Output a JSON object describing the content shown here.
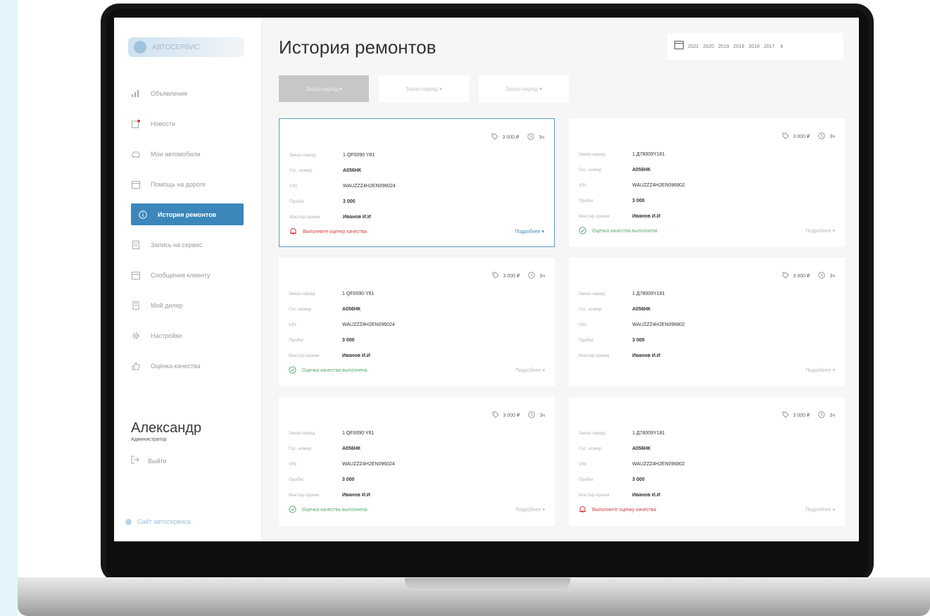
{
  "page": {
    "title": "История ремонтов"
  },
  "logo": {
    "text": "АВТОСЕРВИС"
  },
  "sidebar": {
    "items": [
      {
        "label": "Объявления",
        "icon": "chart-icon",
        "active": false
      },
      {
        "label": "Новости",
        "icon": "news-icon",
        "active": false
      },
      {
        "label": "Мои автомобили",
        "icon": "car-icon",
        "active": false
      },
      {
        "label": "Помощь на дороге",
        "icon": "calendar-icon",
        "active": false
      },
      {
        "label": "История ремонтов",
        "icon": "info-icon",
        "active": true
      },
      {
        "label": "Запись на сервис",
        "icon": "doc-icon",
        "active": false
      },
      {
        "label": "Сообщения клиенту",
        "icon": "calendar-icon",
        "active": false
      },
      {
        "label": "Мой дилер",
        "icon": "building-icon",
        "active": false
      },
      {
        "label": "Настройки",
        "icon": "gear-icon",
        "active": false
      },
      {
        "label": "Оценка качества",
        "icon": "thumb-icon",
        "active": false
      }
    ]
  },
  "user": {
    "name": "Александр",
    "role": "Администратор",
    "logout_label": "Выйти"
  },
  "footer": {
    "link": "Сайт автосервиса"
  },
  "years": [
    "2021",
    "2020",
    "2019",
    "2018",
    "2018",
    "2017"
  ],
  "filters": [
    {
      "label": "Заказ-наряд ▾",
      "active": true
    },
    {
      "label": "Заказ-наряд ▾",
      "active": false
    },
    {
      "label": "Заказ-наряд ▾",
      "active": false
    }
  ],
  "labels": {
    "order": "Заказ-наряд",
    "plate": "Гос. номер",
    "vin": "VIN",
    "mileage": "Пробег",
    "master": "Мастер-прием",
    "details": "Подробнее ▾"
  },
  "cards": [
    {
      "price": "3 000 ₽",
      "time": "3ч",
      "order": "1 QF0090 Y81",
      "plate": "А056НК",
      "vin": "WAUZZZ4H2EN096024",
      "mileage": "3 000",
      "master": "Иванов И.И",
      "status": "Выполните оценку качества",
      "status_type": "err",
      "selected": true
    },
    {
      "price": "3 000 ₽",
      "time": "3ч",
      "order": "1 Д78009Y181",
      "plate": "А056НК",
      "vin": "WAUZZZ4H2EN096802",
      "mileage": "3 000",
      "master": "Иванов И.И",
      "status": "Оценка качества выполнена",
      "status_type": "ok",
      "selected": false
    },
    {
      "price": "3 000 ₽",
      "time": "3ч",
      "order": "1 QF0090 Y81",
      "plate": "А056НК",
      "vin": "WAUZZZ4H2EN096024",
      "mileage": "3 000",
      "master": "Иванов И.И",
      "status": "Оценка качества выполнена",
      "status_type": "ok",
      "selected": false
    },
    {
      "price": "3 000 ₽",
      "time": "3ч",
      "order": "1 Д78009Y181",
      "plate": "А056НК",
      "vin": "WAUZZZ4H2EN096802",
      "mileage": "3 000",
      "master": "Иванов И.И",
      "status": "",
      "status_type": "none",
      "selected": false
    },
    {
      "price": "3 000 ₽",
      "time": "3ч",
      "order": "1 QF0090 Y81",
      "plate": "А056НК",
      "vin": "WAUZZZ4H2EN096024",
      "mileage": "3 000",
      "master": "Иванов И.И",
      "status": "Оценка качества выполнена",
      "status_type": "ok",
      "selected": false
    },
    {
      "price": "3 000 ₽",
      "time": "3ч",
      "order": "1 Д78009Y181",
      "plate": "А056НК",
      "vin": "WAUZZZ4H2EN096802",
      "mileage": "3 000",
      "master": "Иванов И.И",
      "status": "Выполните оценку качества",
      "status_type": "err",
      "selected": false
    }
  ],
  "colors": {
    "accent": "#3b87bb",
    "error": "#d04040",
    "success": "#5caa6e"
  }
}
